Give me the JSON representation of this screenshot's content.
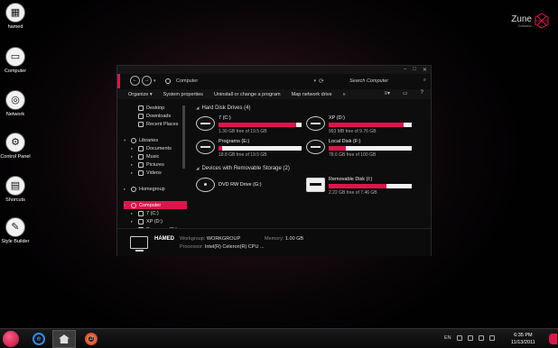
{
  "desktop": {
    "icons": [
      {
        "label": "hamed",
        "icon": "user-folder-icon",
        "glyph": "▦"
      },
      {
        "label": "Computer",
        "icon": "computer-icon",
        "glyph": "▭"
      },
      {
        "label": "Network",
        "icon": "network-icon",
        "glyph": "◎"
      },
      {
        "label": "Control Panel",
        "icon": "gear-icon",
        "glyph": "⚙"
      },
      {
        "label": "Shorcuts",
        "icon": "shortcuts-icon",
        "glyph": "▤"
      },
      {
        "label": "Style Builder",
        "icon": "style-builder-icon",
        "glyph": "✎"
      }
    ],
    "brand": {
      "title": "Zune",
      "subtitle": "Collection"
    }
  },
  "window": {
    "controls": {
      "minimize": "–",
      "maximize": "□",
      "close": "✕"
    },
    "nav": {
      "back": "←",
      "forward": "→",
      "recent": "▾"
    },
    "address": {
      "text": "Computer",
      "dropdown": "▾",
      "refresh": "⟳"
    },
    "search": {
      "placeholder": "Search Computer",
      "icon": "⌕"
    },
    "toolbar": {
      "items": [
        "Organize ▾",
        "System properties",
        "Uninstall or change a program",
        "Map network drive",
        "»"
      ],
      "views": "≡▾",
      "pane": "▭",
      "help": "?"
    },
    "sidebar": {
      "items": [
        {
          "label": "Desktop",
          "icon": "desktop-icon",
          "indent": 1
        },
        {
          "label": "Downloads",
          "icon": "downloads-icon",
          "indent": 1
        },
        {
          "label": "Recent Places",
          "icon": "recent-places-icon",
          "indent": 1
        },
        {
          "label": "",
          "icon": "",
          "indent": 0
        },
        {
          "label": "Libraries",
          "icon": "libraries-icon",
          "indent": 0,
          "arrow": "▾"
        },
        {
          "label": "Documents",
          "icon": "documents-icon",
          "indent": 1,
          "arrow": "▸"
        },
        {
          "label": "Music",
          "icon": "music-icon",
          "indent": 1,
          "arrow": "▸"
        },
        {
          "label": "Pictures",
          "icon": "pictures-icon",
          "indent": 1,
          "arrow": "▸"
        },
        {
          "label": "Videos",
          "icon": "videos-icon",
          "indent": 1,
          "arrow": "▸"
        },
        {
          "label": "",
          "icon": "",
          "indent": 0
        },
        {
          "label": "Homegroup",
          "icon": "homegroup-icon",
          "indent": 0,
          "arrow": "▸"
        },
        {
          "label": "",
          "icon": "",
          "indent": 0
        },
        {
          "label": "Computer",
          "icon": "computer-icon",
          "indent": 0,
          "arrow": "▾",
          "selected": true
        },
        {
          "label": "7 (C:)",
          "icon": "drive-icon",
          "indent": 1,
          "arrow": "▸"
        },
        {
          "label": "XP (D:)",
          "icon": "drive-icon",
          "indent": 1,
          "arrow": "▸"
        },
        {
          "label": "Programs (E:)",
          "icon": "drive-icon",
          "indent": 1,
          "arrow": "▸"
        }
      ]
    },
    "groups": {
      "hdd": {
        "title": "Hard Disk Drives (4)",
        "caret": "◢"
      },
      "removable": {
        "title": "Devices with Removable Storage (2)",
        "caret": "◢"
      }
    },
    "drives": [
      {
        "name": "7 (C:)",
        "free": "1.30 GB free of 19.5 GB",
        "used_pct": 93,
        "type": "hdd"
      },
      {
        "name": "XP (D:)",
        "free": "993 MB free of 9.76 GB",
        "used_pct": 90,
        "type": "hdd"
      },
      {
        "name": "Programs (E:)",
        "free": "18.8 GB free of 19.5 GB",
        "used_pct": 4,
        "type": "hdd"
      },
      {
        "name": "Local Disk (F:)",
        "free": "78.6 GB free of 100 GB",
        "used_pct": 21,
        "type": "hdd"
      },
      {
        "name": "DVD RW Drive (G:)",
        "free": "",
        "used_pct": null,
        "type": "dvd"
      },
      {
        "name": "Removable Disk (I:)",
        "free": "2.22 GB free of 7.46 GB",
        "used_pct": 70,
        "type": "removable"
      }
    ],
    "details": {
      "hostname": "HAMED",
      "workgroup_label": "Workgroup:",
      "workgroup": "WORKGROUP",
      "memory_label": "Memory:",
      "memory": "1.00 GB",
      "processor_label": "Processor:",
      "processor": "Intel(R) Celeron(R) CPU ..."
    }
  },
  "taskbar": {
    "language": "EN",
    "time": "6:35 PM",
    "date": "11/13/2011",
    "tray_icons": [
      "volume-icon",
      "network-tray-icon",
      "flag-icon",
      "battery-icon"
    ]
  },
  "colors": {
    "accent": "#e0144d",
    "window_bg": "#0d0d0e",
    "bar_bg": "#f2f2f2"
  }
}
